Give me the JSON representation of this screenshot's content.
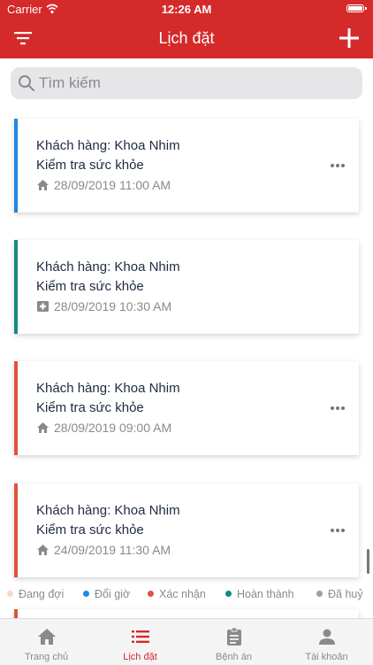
{
  "status_bar": {
    "carrier": "Carrier",
    "time": "12:26 AM"
  },
  "header": {
    "title": "Lịch đặt"
  },
  "search": {
    "placeholder": "Tìm kiếm"
  },
  "appointments": [
    {
      "customer": "Khách hàng: Khoa Nhim",
      "service": "Kiểm tra sức khỏe",
      "datetime": "28/09/2019 11:00 AM",
      "type_icon": "home-icon",
      "status_color": "#1e88e5"
    },
    {
      "customer": "Khách hàng: Khoa Nhim",
      "service": "Kiểm tra sức khỏe",
      "datetime": "28/09/2019 10:30 AM",
      "type_icon": "medical-cross-icon",
      "status_color": "#138a7d"
    },
    {
      "customer": "Khách hàng: Khoa Nhim",
      "service": "Kiểm tra sức khỏe",
      "datetime": "28/09/2019 09:00 AM",
      "type_icon": "home-icon",
      "status_color": "#e0533c"
    },
    {
      "customer": "Khách hàng: Khoa Nhim",
      "service": "Kiểm tra sức khỏe",
      "datetime": "24/09/2019 11:30 AM",
      "type_icon": "home-icon",
      "status_color": "#e0533c"
    }
  ],
  "legend": [
    {
      "label": "Đang đợi",
      "color": "#f6d9c0"
    },
    {
      "label": "Đổi giờ",
      "color": "#1e88e5"
    },
    {
      "label": "Xác nhận",
      "color": "#e0533c"
    },
    {
      "label": "Hoàn thành",
      "color": "#138a7d"
    },
    {
      "label": "Đã huỷ",
      "color": "#9e9e9e"
    }
  ],
  "tabs": [
    {
      "label": "Trang chủ",
      "icon": "home-icon"
    },
    {
      "label": "Lịch đặt",
      "icon": "list-icon",
      "active": true
    },
    {
      "label": "Bệnh án",
      "icon": "clipboard-icon"
    },
    {
      "label": "Tài khoản",
      "icon": "user-icon"
    }
  ],
  "colors": {
    "brand": "#d42a2a",
    "inactive": "#8a8a8e"
  }
}
